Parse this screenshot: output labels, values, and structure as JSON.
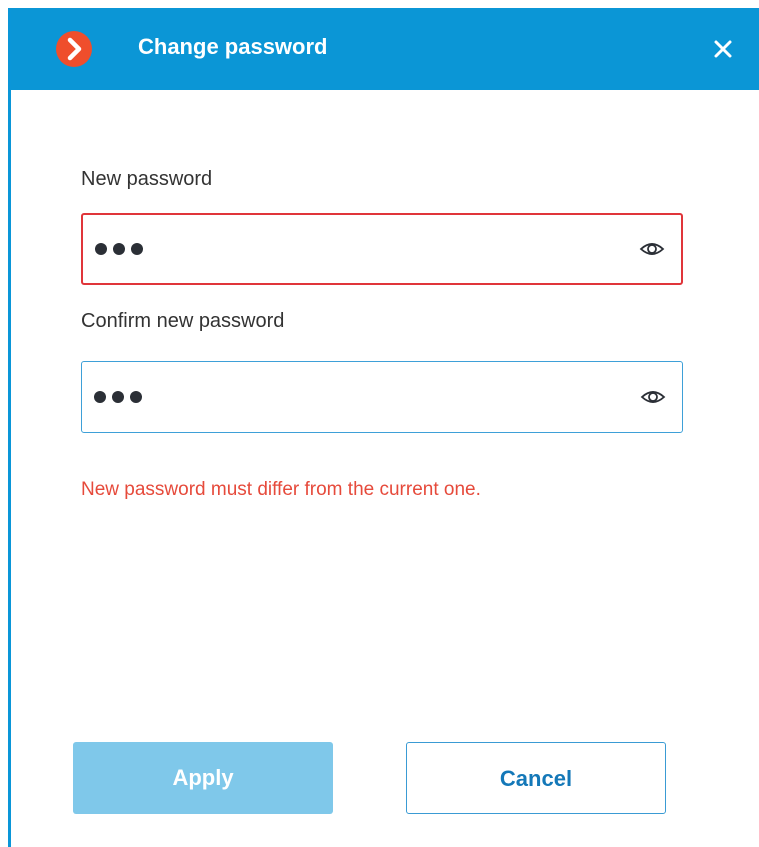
{
  "window": {
    "title": "Change password",
    "logo_icon": "chevron-right-logo-icon",
    "close_icon": "close-icon",
    "titlebar_color": "#0b96d6"
  },
  "form": {
    "new_password": {
      "label": "New password",
      "masked_length": 3,
      "state": "error",
      "toggle_icon": "eye-icon"
    },
    "confirm_password": {
      "label": "Confirm new password",
      "masked_length": 3,
      "toggle_icon": "eye-icon"
    },
    "error_message": "New password must differ from the current one.",
    "error_color": "#e64a3b"
  },
  "buttons": {
    "apply_label": "Apply",
    "apply_disabled": true,
    "cancel_label": "Cancel"
  }
}
